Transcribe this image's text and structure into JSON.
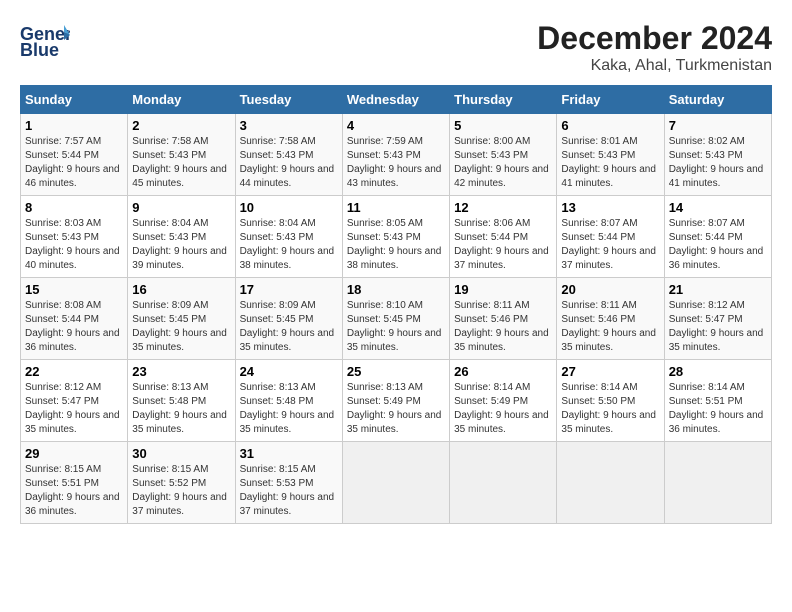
{
  "logo": {
    "text1": "General",
    "text2": "Blue"
  },
  "title": "December 2024",
  "subtitle": "Kaka, Ahal, Turkmenistan",
  "days_of_week": [
    "Sunday",
    "Monday",
    "Tuesday",
    "Wednesday",
    "Thursday",
    "Friday",
    "Saturday"
  ],
  "weeks": [
    [
      {
        "day": "1",
        "sunrise": "7:57 AM",
        "sunset": "5:44 PM",
        "daylight": "9 hours and 46 minutes."
      },
      {
        "day": "2",
        "sunrise": "7:58 AM",
        "sunset": "5:43 PM",
        "daylight": "9 hours and 45 minutes."
      },
      {
        "day": "3",
        "sunrise": "7:58 AM",
        "sunset": "5:43 PM",
        "daylight": "9 hours and 44 minutes."
      },
      {
        "day": "4",
        "sunrise": "7:59 AM",
        "sunset": "5:43 PM",
        "daylight": "9 hours and 43 minutes."
      },
      {
        "day": "5",
        "sunrise": "8:00 AM",
        "sunset": "5:43 PM",
        "daylight": "9 hours and 42 minutes."
      },
      {
        "day": "6",
        "sunrise": "8:01 AM",
        "sunset": "5:43 PM",
        "daylight": "9 hours and 41 minutes."
      },
      {
        "day": "7",
        "sunrise": "8:02 AM",
        "sunset": "5:43 PM",
        "daylight": "9 hours and 41 minutes."
      }
    ],
    [
      {
        "day": "8",
        "sunrise": "8:03 AM",
        "sunset": "5:43 PM",
        "daylight": "9 hours and 40 minutes."
      },
      {
        "day": "9",
        "sunrise": "8:04 AM",
        "sunset": "5:43 PM",
        "daylight": "9 hours and 39 minutes."
      },
      {
        "day": "10",
        "sunrise": "8:04 AM",
        "sunset": "5:43 PM",
        "daylight": "9 hours and 38 minutes."
      },
      {
        "day": "11",
        "sunrise": "8:05 AM",
        "sunset": "5:43 PM",
        "daylight": "9 hours and 38 minutes."
      },
      {
        "day": "12",
        "sunrise": "8:06 AM",
        "sunset": "5:44 PM",
        "daylight": "9 hours and 37 minutes."
      },
      {
        "day": "13",
        "sunrise": "8:07 AM",
        "sunset": "5:44 PM",
        "daylight": "9 hours and 37 minutes."
      },
      {
        "day": "14",
        "sunrise": "8:07 AM",
        "sunset": "5:44 PM",
        "daylight": "9 hours and 36 minutes."
      }
    ],
    [
      {
        "day": "15",
        "sunrise": "8:08 AM",
        "sunset": "5:44 PM",
        "daylight": "9 hours and 36 minutes."
      },
      {
        "day": "16",
        "sunrise": "8:09 AM",
        "sunset": "5:45 PM",
        "daylight": "9 hours and 35 minutes."
      },
      {
        "day": "17",
        "sunrise": "8:09 AM",
        "sunset": "5:45 PM",
        "daylight": "9 hours and 35 minutes."
      },
      {
        "day": "18",
        "sunrise": "8:10 AM",
        "sunset": "5:45 PM",
        "daylight": "9 hours and 35 minutes."
      },
      {
        "day": "19",
        "sunrise": "8:11 AM",
        "sunset": "5:46 PM",
        "daylight": "9 hours and 35 minutes."
      },
      {
        "day": "20",
        "sunrise": "8:11 AM",
        "sunset": "5:46 PM",
        "daylight": "9 hours and 35 minutes."
      },
      {
        "day": "21",
        "sunrise": "8:12 AM",
        "sunset": "5:47 PM",
        "daylight": "9 hours and 35 minutes."
      }
    ],
    [
      {
        "day": "22",
        "sunrise": "8:12 AM",
        "sunset": "5:47 PM",
        "daylight": "9 hours and 35 minutes."
      },
      {
        "day": "23",
        "sunrise": "8:13 AM",
        "sunset": "5:48 PM",
        "daylight": "9 hours and 35 minutes."
      },
      {
        "day": "24",
        "sunrise": "8:13 AM",
        "sunset": "5:48 PM",
        "daylight": "9 hours and 35 minutes."
      },
      {
        "day": "25",
        "sunrise": "8:13 AM",
        "sunset": "5:49 PM",
        "daylight": "9 hours and 35 minutes."
      },
      {
        "day": "26",
        "sunrise": "8:14 AM",
        "sunset": "5:49 PM",
        "daylight": "9 hours and 35 minutes."
      },
      {
        "day": "27",
        "sunrise": "8:14 AM",
        "sunset": "5:50 PM",
        "daylight": "9 hours and 35 minutes."
      },
      {
        "day": "28",
        "sunrise": "8:14 AM",
        "sunset": "5:51 PM",
        "daylight": "9 hours and 36 minutes."
      }
    ],
    [
      {
        "day": "29",
        "sunrise": "8:15 AM",
        "sunset": "5:51 PM",
        "daylight": "9 hours and 36 minutes."
      },
      {
        "day": "30",
        "sunrise": "8:15 AM",
        "sunset": "5:52 PM",
        "daylight": "9 hours and 37 minutes."
      },
      {
        "day": "31",
        "sunrise": "8:15 AM",
        "sunset": "5:53 PM",
        "daylight": "9 hours and 37 minutes."
      },
      null,
      null,
      null,
      null
    ]
  ]
}
